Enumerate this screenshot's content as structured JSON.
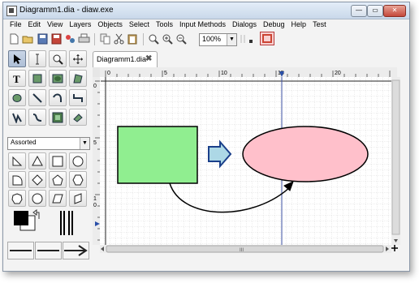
{
  "window": {
    "title": "Diagramm1.dia - diaw.exe",
    "controls": {
      "minimize": "—",
      "maximize": "▭",
      "close": "✕"
    }
  },
  "menu": [
    "File",
    "Edit",
    "View",
    "Layers",
    "Objects",
    "Select",
    "Tools",
    "Input Methods",
    "Dialogs",
    "Debug",
    "Help",
    "Test"
  ],
  "toolbar": {
    "zoom_value": "100%",
    "icons": [
      "new-icon",
      "open-icon",
      "save-icon",
      "save-as-icon",
      "export-icon",
      "print-icon",
      "copy-icon",
      "cut-icon",
      "paste-icon",
      "zoom-fit-icon",
      "zoom-in-icon",
      "zoom-out-icon"
    ]
  },
  "toolbox": {
    "tools": [
      "pointer",
      "text-edit",
      "magnify",
      "scroll",
      "text",
      "box",
      "ellipse",
      "polygon",
      "beziergon",
      "line",
      "arc",
      "zigzag",
      "polyline",
      "bezierline",
      "image",
      "outline"
    ],
    "sheet_selector": "Assorted",
    "sheet_shapes": [
      "right-triangle",
      "triangle",
      "square",
      "circle",
      "quarter-circle",
      "diamond",
      "pentagon",
      "hexagon",
      "heptagon",
      "octagon",
      "parallelogram",
      "cylinder-face"
    ]
  },
  "tab": {
    "label": "Diagramm1.dia"
  },
  "ruler": {
    "horizontal_labels": [
      "0",
      "5",
      "10",
      "15",
      "20"
    ],
    "vertical_labels": [
      "0",
      "5",
      "1\n0"
    ]
  },
  "colors": {
    "rectangle_fill": "#90ee90",
    "ellipse_fill": "#ffc0cb",
    "arrow_fill": "#add8e6",
    "canvas_bg": "#ffffff",
    "grid": "#d8d8d8"
  },
  "scroll_grip": "III"
}
